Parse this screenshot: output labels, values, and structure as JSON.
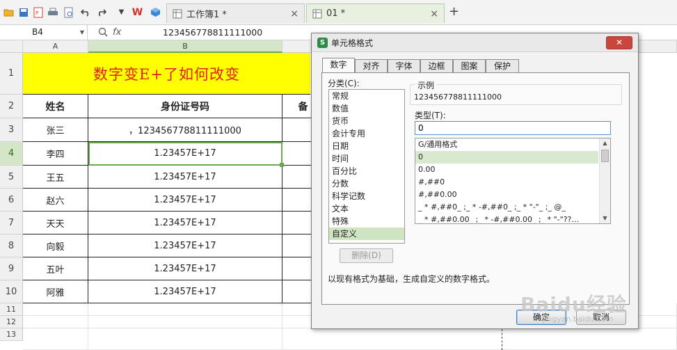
{
  "toolbar": {
    "icons": [
      "open-folder-icon",
      "save-icon",
      "export-pdf-icon",
      "print-icon",
      "print-preview-icon",
      "undo-icon",
      "redo-icon",
      "more-icon",
      "wps-logo-icon",
      "cube-icon"
    ],
    "tabs": [
      {
        "label": "工作簿1 *",
        "close": "×"
      },
      {
        "label": "01 *",
        "close": "×"
      }
    ],
    "new_tab": "+"
  },
  "formula_bar": {
    "name_box": "B4",
    "fx": "fx",
    "value": "123456778811111000"
  },
  "columns": [
    "A",
    "B"
  ],
  "rows": [
    "1",
    "2",
    "3",
    "4",
    "5",
    "6",
    "7",
    "8",
    "9",
    "10",
    "11",
    "12",
    "13"
  ],
  "sheet": {
    "title": "数字变E+了如何改变",
    "headers": {
      "name": "姓名",
      "id": "身份证号码",
      "third": "备"
    },
    "data": [
      {
        "name": "张三",
        "id": "，123456778811111000"
      },
      {
        "name": "李四",
        "id": "1.23457E+17"
      },
      {
        "name": "王五",
        "id": "1.23457E+17"
      },
      {
        "name": "赵六",
        "id": "1.23457E+17"
      },
      {
        "name": "天天",
        "id": "1.23457E+17"
      },
      {
        "name": "向毅",
        "id": "1.23457E+17"
      },
      {
        "name": "五叶",
        "id": "1.23457E+17"
      },
      {
        "name": "阿雅",
        "id": "1.23457E+17"
      }
    ]
  },
  "dialog": {
    "logo": "S",
    "title": "单元格格式",
    "close": "✕",
    "tabs": [
      "数字",
      "对齐",
      "字体",
      "边框",
      "图案",
      "保护"
    ],
    "category_label": "分类(C):",
    "categories": [
      "常规",
      "数值",
      "货币",
      "会计专用",
      "日期",
      "时间",
      "百分比",
      "分数",
      "科学记数",
      "文本",
      "特殊",
      "自定义"
    ],
    "selected_category": "自定义",
    "delete_button": "删除(D)",
    "sample_label": "示例",
    "sample_value": "123456778811111000",
    "type_label": "类型(T):",
    "type_value": "0",
    "formats": [
      "G/通用格式",
      "0",
      "0.00",
      "#,##0",
      "#,##0.00",
      "_ * #,##0_ ;_ * -#,##0_ ;_ * \"-\"_ ;_ @_",
      "_ * #,##0.00_ ;_ * -#,##0.00_ ;_ * \"-\"??…"
    ],
    "description": "以现有格式为基础，生成自定义的数字格式。",
    "ok_button": "确定",
    "cancel_button": "取消"
  },
  "watermark": {
    "text": "Baidu经验",
    "sub": "jingyan.baidu.com"
  },
  "colors": {
    "title_fill": "#ffff00",
    "title_text": "#e0201b",
    "selection": "#6aa84f",
    "close_button": "#c9463d"
  }
}
